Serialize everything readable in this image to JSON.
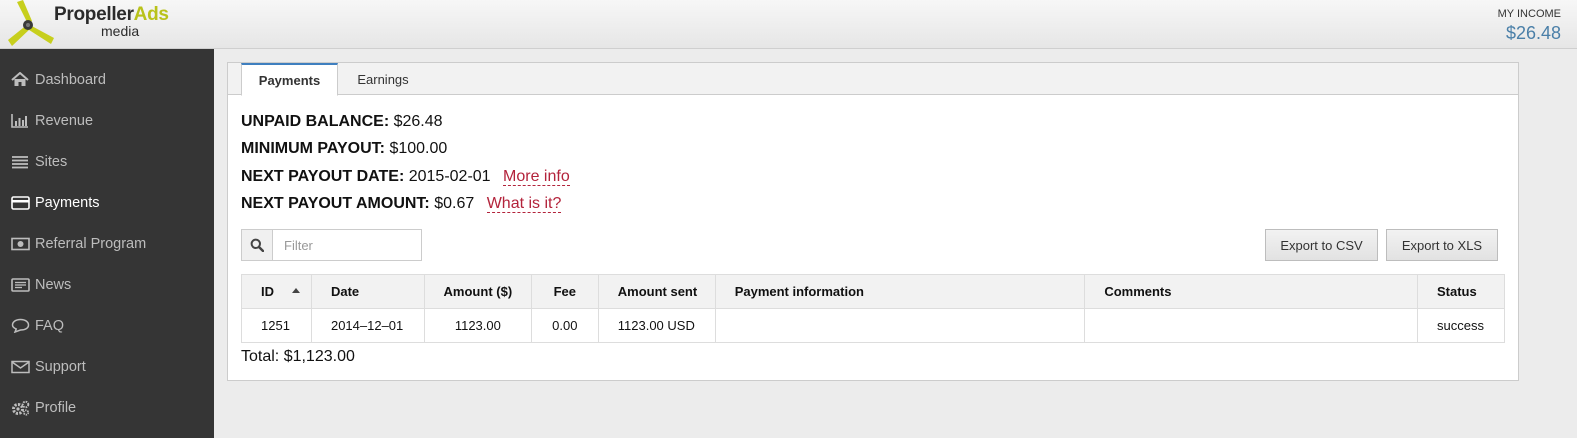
{
  "brand": {
    "name_main": "Propeller",
    "name_accent": "Ads",
    "name_sub": "media"
  },
  "income": {
    "label": "MY INCOME",
    "value": "$26.48"
  },
  "sidebar": {
    "items": [
      {
        "label": "Dashboard",
        "icon": "home-icon"
      },
      {
        "label": "Revenue",
        "icon": "bar-chart-icon"
      },
      {
        "label": "Sites",
        "icon": "list-icon"
      },
      {
        "label": "Payments",
        "icon": "credit-card-icon",
        "active": true
      },
      {
        "label": "Referral Program",
        "icon": "money-icon"
      },
      {
        "label": "News",
        "icon": "newspaper-icon"
      },
      {
        "label": "FAQ",
        "icon": "speech-bubble-icon"
      },
      {
        "label": "Support",
        "icon": "envelope-icon"
      },
      {
        "label": "Profile",
        "icon": "gears-icon"
      }
    ]
  },
  "tabs": [
    {
      "label": "Payments",
      "active": true
    },
    {
      "label": "Earnings"
    }
  ],
  "summary": {
    "unpaid_label": "UNPAID BALANCE:",
    "unpaid_value": "$26.48",
    "minimum_label": "MINIMUM PAYOUT:",
    "minimum_value": "$100.00",
    "next_date_label": "NEXT PAYOUT DATE:",
    "next_date_value": "2015-02-01",
    "next_date_link": "More info",
    "next_amount_label": "NEXT PAYOUT AMOUNT:",
    "next_amount_value": "$0.67",
    "next_amount_link": "What is it?"
  },
  "filter": {
    "placeholder": "Filter"
  },
  "export": {
    "csv": "Export to CSV",
    "xls": "Export to XLS"
  },
  "table": {
    "columns": [
      "ID",
      "Date",
      "Amount ($)",
      "Fee",
      "Amount sent",
      "Payment information",
      "Comments",
      "Status"
    ],
    "rows": [
      {
        "id": "1251",
        "date": "2014–12–01",
        "amount": "1123.00",
        "fee": "0.00",
        "amount_sent": "1123.00 USD",
        "payment_info": "",
        "comments": "",
        "status": "success"
      }
    ]
  },
  "total": "Total: $1,123.00",
  "colors": {
    "accent": "#b9c21a",
    "link": "#b3233b",
    "income": "#4a7fa8",
    "sidebar": "#353535",
    "tab_active_border": "#3f7fbf"
  }
}
